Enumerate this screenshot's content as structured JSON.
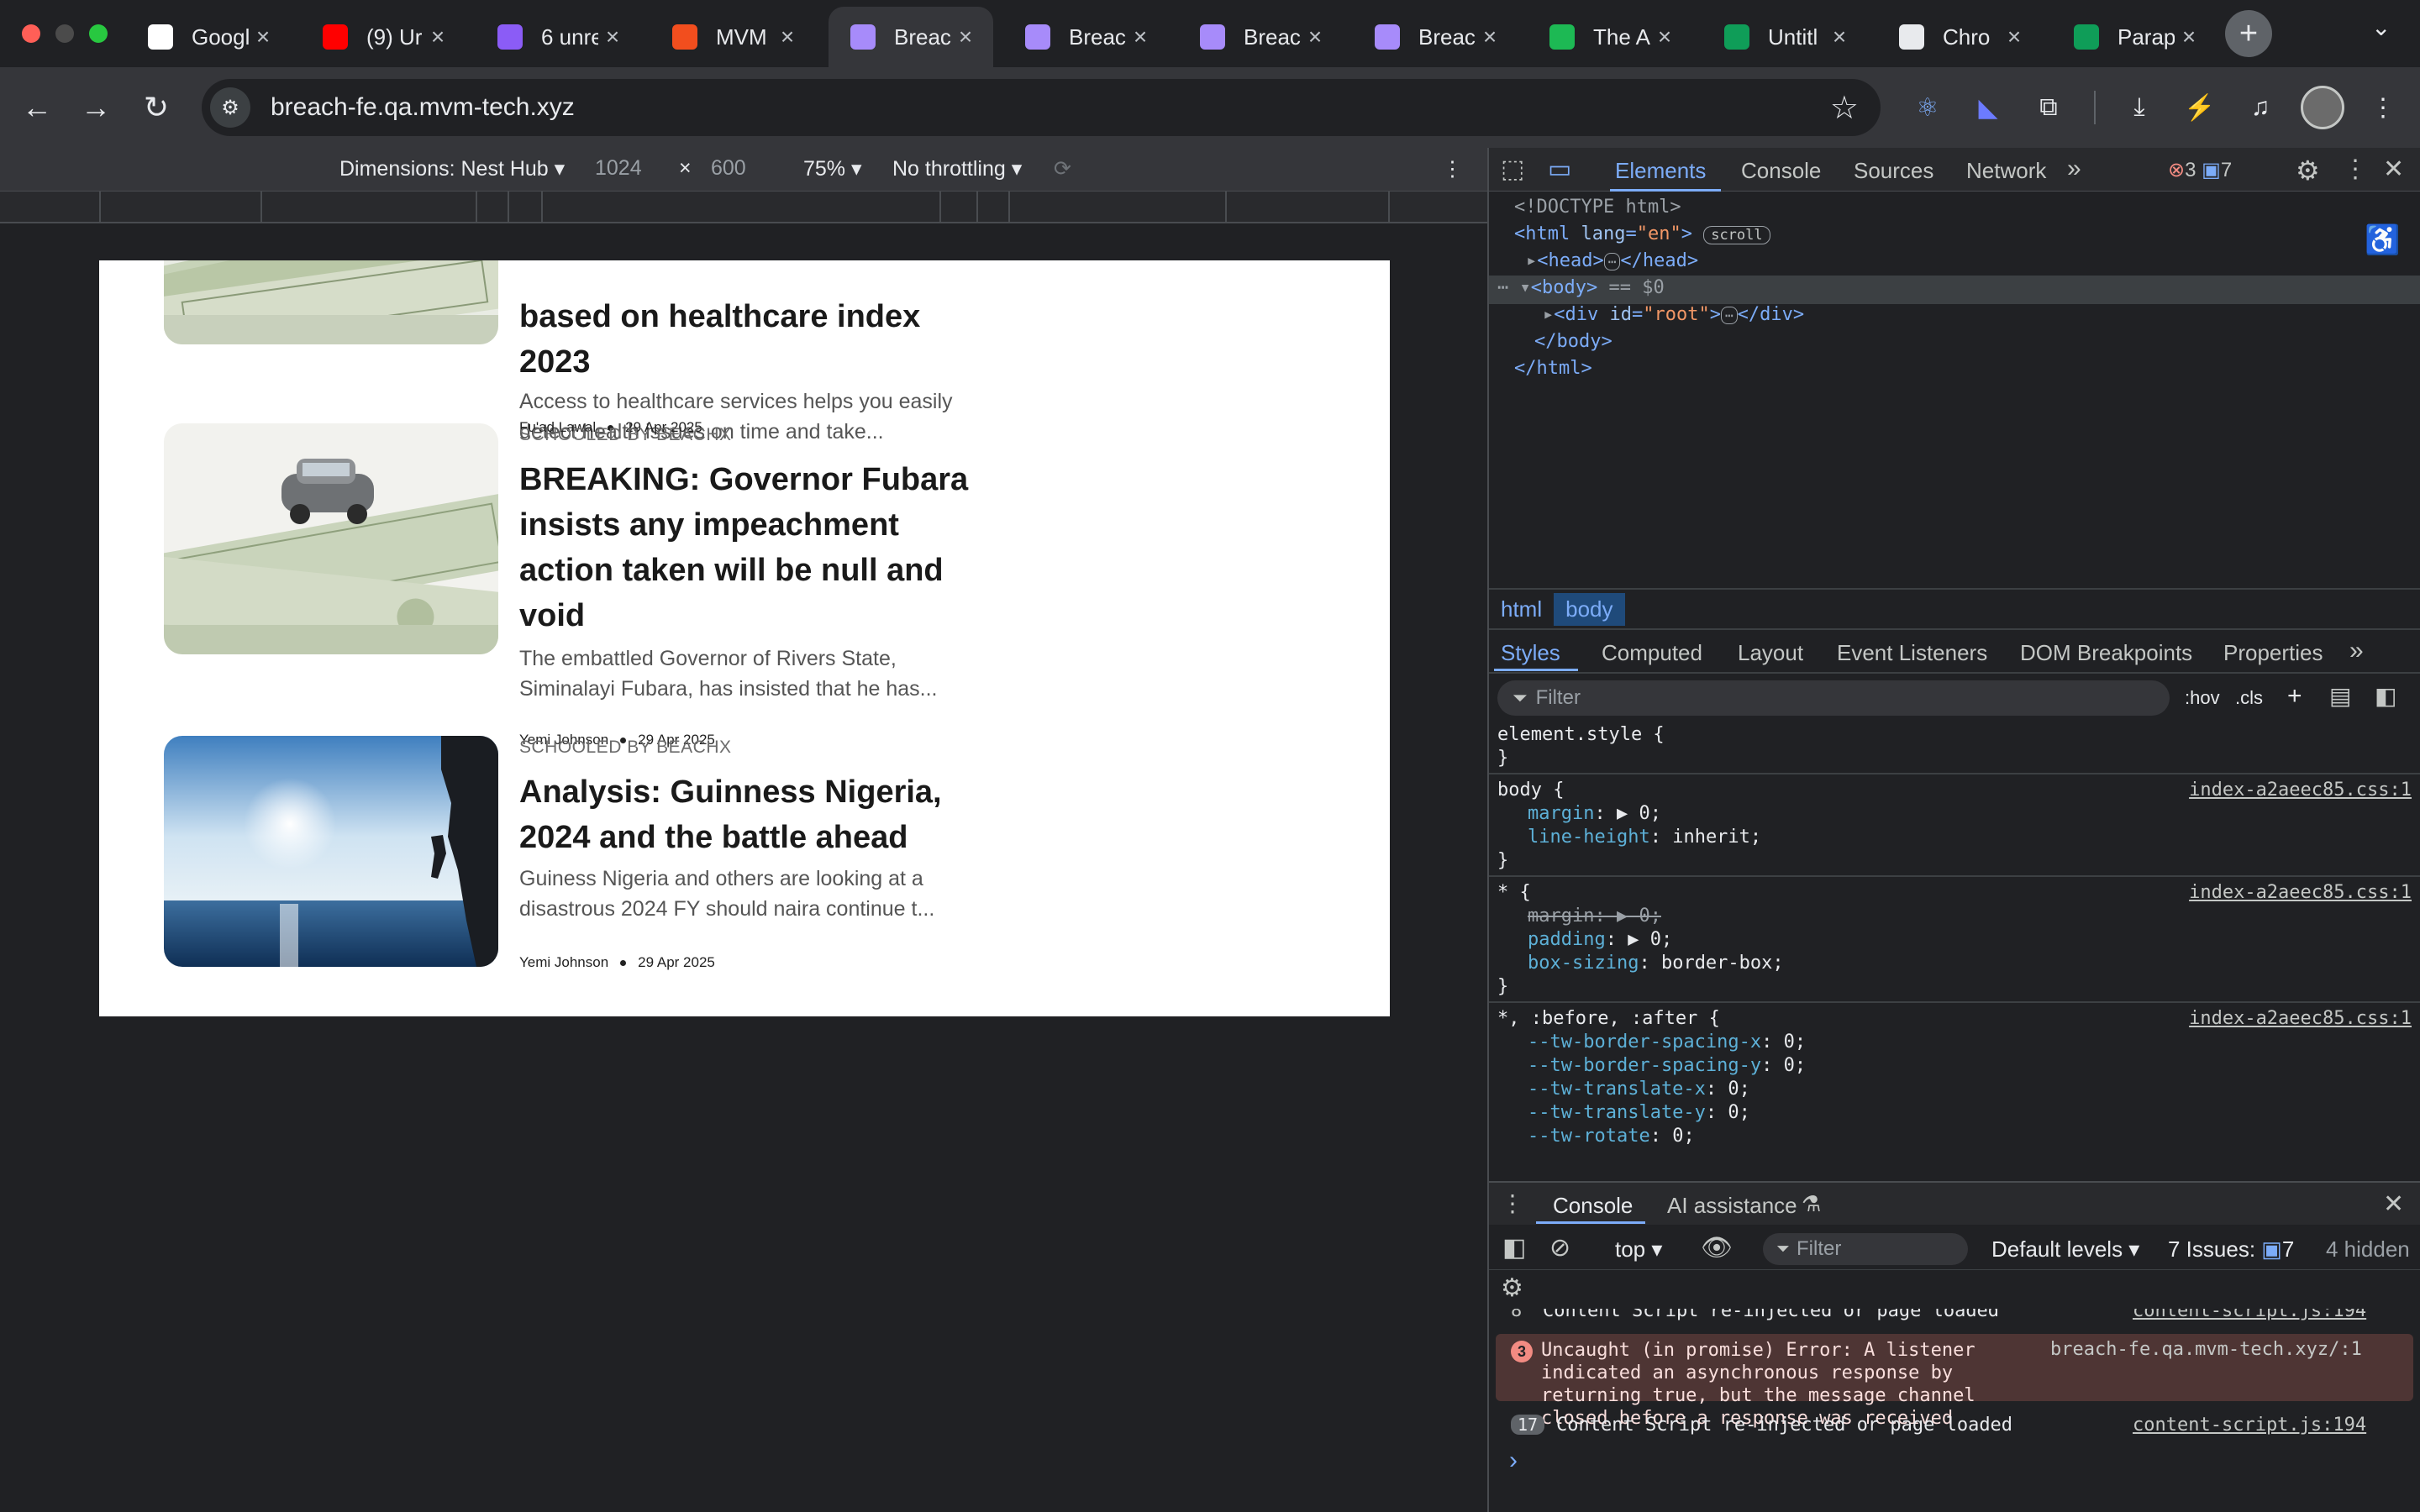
{
  "browser": {
    "tabs": [
      {
        "title": "Google",
        "icon": "google-icon",
        "color": "#ffffff"
      },
      {
        "title": "(9) Ur",
        "icon": "youtube-icon",
        "color": "#ff0000"
      },
      {
        "title": "6 unre",
        "icon": "mail-icon",
        "color": "#8b5cf6"
      },
      {
        "title": "MVM",
        "icon": "figma-icon",
        "color": "#f24e1e"
      },
      {
        "title": "Breac",
        "icon": "vite-icon",
        "color": "#a78bfa",
        "active": true
      },
      {
        "title": "Breac",
        "icon": "vite-icon",
        "color": "#a78bfa"
      },
      {
        "title": "Breac",
        "icon": "vite-icon",
        "color": "#a78bfa"
      },
      {
        "title": "Breac",
        "icon": "vite-icon",
        "color": "#a78bfa"
      },
      {
        "title": "The A",
        "icon": "spotify-icon",
        "color": "#1db954"
      },
      {
        "title": "Untitl",
        "icon": "sheets-icon",
        "color": "#0f9d58"
      },
      {
        "title": "Chro",
        "icon": "chatgpt-icon",
        "color": "#e8eaed"
      },
      {
        "title": "Parap",
        "icon": "sheets-icon",
        "color": "#0f9d58"
      }
    ],
    "url": "breach-fe.qa.mvm-tech.xyz"
  },
  "device_toolbar": {
    "dimensions_label": "Dimensions: Nest Hub",
    "width": "1024",
    "times": "×",
    "height": "600",
    "zoom": "75%",
    "throttling": "No throttling"
  },
  "articles": [
    {
      "headline": "based on healthcare index 2023",
      "excerpt": "Access to healthcare services helps you easily detect health issues on time and take...",
      "image": "money-car",
      "kicker": "",
      "author": "Fu'ad Lawal",
      "date": "29 Apr 2025"
    },
    {
      "kicker": "SCHOOLED BY BEACHX",
      "headline": "BREAKING: Governor Fubara insists any impeachment action taken will be null and void",
      "excerpt": "The embattled Governor of Rivers State, Siminalayi Fubara, has insisted that he has...",
      "author": "Yemi Johnson",
      "date": "29 Apr 2025",
      "image": "money-car"
    },
    {
      "kicker": "SCHOOLED BY BEACHX",
      "headline": "Analysis: Guinness Nigeria, 2024 and the battle ahead",
      "excerpt": "Guiness Nigeria and others are looking at a disastrous 2024 FY should naira continue t...",
      "author": "Yemi Johnson",
      "date": "29 Apr 2025",
      "image": "sea-climber"
    }
  ],
  "devtools": {
    "tabs": [
      "Elements",
      "Console",
      "Sources",
      "Network"
    ],
    "more": "»",
    "error_count": "3",
    "issue_count": "7",
    "dom": {
      "doctype": "<!DOCTYPE html>",
      "html_open": "<html",
      "lang_attr": "lang",
      "lang_val": "\"en\"",
      "scroll_badge": "scroll",
      "head": "<head>",
      "head_close": "</head>",
      "body": "<body>",
      "body_eq": "== $0",
      "div_open": "<div",
      "id_attr": "id",
      "id_val": "\"root\"",
      "div_close": "</div>",
      "body_close": "</body>",
      "html_close": "</html>"
    },
    "breadcrumbs": [
      "html",
      "body"
    ],
    "style_tabs": [
      "Styles",
      "Computed",
      "Layout",
      "Event Listeners",
      "DOM Breakpoints",
      "Properties"
    ],
    "filter_placeholder": "Filter",
    "hov": ":hov",
    "cls": ".cls",
    "rules": [
      {
        "selector": "element.style {",
        "source": "",
        "props": []
      },
      {
        "selector": "body {",
        "source": "index-a2aeec85.css:1",
        "props": [
          {
            "name": "margin",
            "value": "▶ 0;"
          },
          {
            "name": "line-height",
            "value": "inherit;"
          }
        ]
      },
      {
        "selector": "* {",
        "source": "index-a2aeec85.css:1",
        "props": [
          {
            "name": "margin",
            "value": "▶ 0;",
            "struck": true
          },
          {
            "name": "padding",
            "value": "▶ 0;"
          },
          {
            "name": "box-sizing",
            "value": "border-box;"
          }
        ]
      },
      {
        "selector": "*, :before, :after {",
        "source": "index-a2aeec85.css:1",
        "props": [
          {
            "name": "--tw-border-spacing-x",
            "value": "0;"
          },
          {
            "name": "--tw-border-spacing-y",
            "value": "0;"
          },
          {
            "name": "--tw-translate-x",
            "value": "0;"
          },
          {
            "name": "--tw-translate-y",
            "value": "0;"
          },
          {
            "name": "--tw-rotate",
            "value": "0;"
          }
        ]
      }
    ],
    "drawer": {
      "tabs": [
        "Console",
        "AI assistance"
      ],
      "context": "top",
      "filter_placeholder": "Filter",
      "levels": "Default levels",
      "issues_label": "7 Issues:",
      "issues_count": "7",
      "hidden": "4 hidden",
      "messages": [
        {
          "count": "8",
          "text": "Content Script re-injected or page loaded",
          "source": "content-script.js:194",
          "type": "info"
        },
        {
          "count": "3",
          "text": "Uncaught (in promise) Error: A listener indicated an asynchronous response by returning true, but the message channel closed before a response was received",
          "source": "breach-fe.qa.mvm-tech.xyz/:1",
          "type": "error"
        },
        {
          "count": "17",
          "text": "Content Script re-injected or page loaded",
          "source": "content-script.js:194",
          "type": "info"
        }
      ],
      "prompt": "›"
    }
  }
}
